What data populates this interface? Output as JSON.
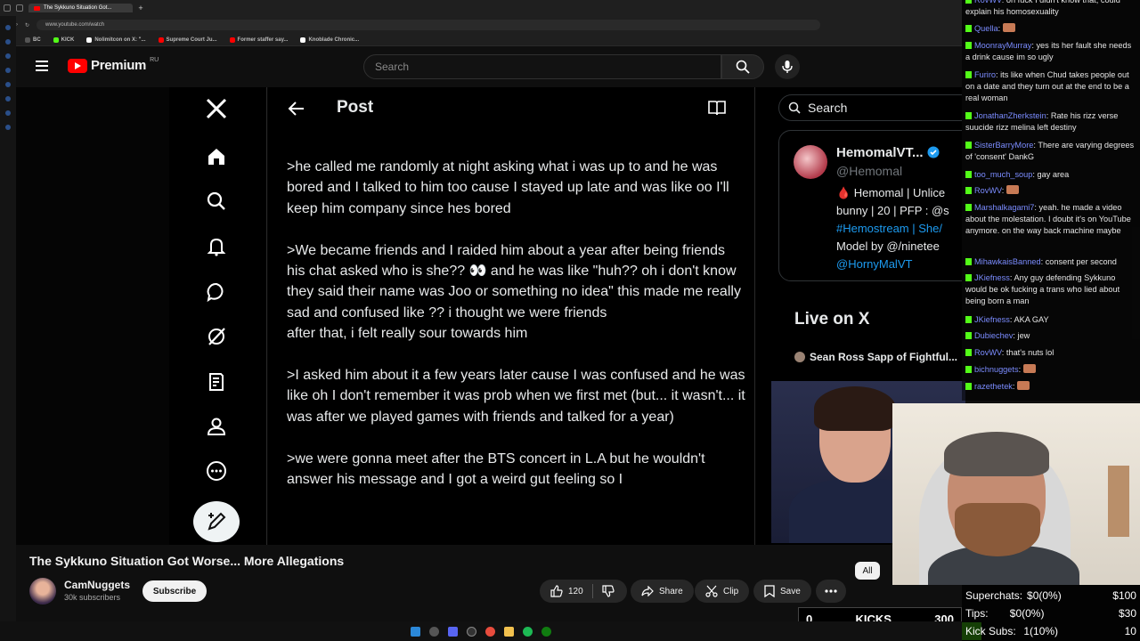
{
  "browser": {
    "active_tab": "The Sykkuno Situation Got...",
    "url": "www.youtube.com/watch",
    "bookmarks": [
      "BC",
      "KICK",
      "Nolimitcon on X: \"...",
      "Supreme Court Ju...",
      "Former staffer say...",
      "Knoblade Chronic..."
    ]
  },
  "youtube": {
    "brand": "Premium",
    "country": "RU",
    "search_placeholder": "Search",
    "video_title": "The Sykkuno Situation Got Worse... More Allegations",
    "channel_name": "CamNuggets",
    "channel_subs": "30k subscribers",
    "subscribe_label": "Subscribe",
    "like_count": "120",
    "share_label": "Share",
    "clip_label": "Clip",
    "save_label": "Save",
    "all_chip": "All",
    "colors": {
      "red": "#ff0000",
      "bg": "#0f0f0f",
      "pill": "#272727"
    }
  },
  "x_post": {
    "title": "Post",
    "paragraphs": [
      ">he called me randomly at night asking what i was up to and he was bored and I talked to him too cause I stayed up late and was like oo I'll keep him company since hes bored",
      ">We became friends and I raided him about a year after being friends",
      "his chat asked who is she?? 👀 and he was like \"huh?? oh i don't know they said their name was Joo or something no idea\" this made me really sad and confused like ?? i thought we were friends",
      "after that, i felt really sour towards him",
      ">I asked him about it a few years later cause I was confused and he was like oh I don't remember it was prob when we first met (but... it wasn't... it was after we played games with friends and talked for a year)",
      ">we were gonna meet after the BTS concert in L.A but he wouldn't answer his message and I got a weird gut feeling so I"
    ],
    "search_placeholder": "Search",
    "profile": {
      "name": "HemomalVT...",
      "handle": "@Hemomal",
      "bio_lines": [
        "🩸 Hemomal | Unlice",
        "bunny | 20 | PFP : @s",
        "#Hemostream | She/",
        "Model by @/ninetee",
        "@HornyMalVT"
      ]
    },
    "live_title": "Live on X",
    "live_item": "Sean Ross Sapp of Fightful..."
  },
  "chat": [
    {
      "user": "RovWV",
      "text": "oh fuck I didn't know that, could explain his homosexuality"
    },
    {
      "user": "Quella",
      "text": ""
    },
    {
      "user": "MoonrayMurray",
      "text": "yes its her fault she needs a drink cause im so ugly"
    },
    {
      "user": "Furiro",
      "text": "its like when Chud takes people out on a date and they turn out at the end to be a real woman"
    },
    {
      "user": "JonathanZherkstein",
      "text": "Rate his rizz verse suucide rizz melina left destiny"
    },
    {
      "user": "SisterBarryMore",
      "text": "There are varying degrees of 'consent' DankG"
    },
    {
      "user": "too_much_soup",
      "text": "gay area"
    },
    {
      "user": "RovWV",
      "text": ""
    },
    {
      "user": "Marshalkagami7",
      "text": "yeah. he made a video about the molestation. I doubt it's on YouTube anymore. on the way back machine maybe"
    },
    {
      "user": "MihawkaisBanned",
      "text": "consent per second"
    },
    {
      "user": "JKiefness",
      "text": "Any guy defending Sykkuno would be ok fucking a trans who lied about being born a man"
    },
    {
      "user": "JKiefness",
      "text": "AKA GAY"
    },
    {
      "user": "Dubiechev",
      "text": "jew"
    },
    {
      "user": "RovWV",
      "text": "that's nuts lol"
    },
    {
      "user": "bichnuggets",
      "text": ""
    },
    {
      "user": "razethetek",
      "text": ""
    }
  ],
  "stats": {
    "rows": [
      {
        "label": "Superchats:",
        "value": "$0(0%)",
        "goal": "$100"
      },
      {
        "label": "Tips:",
        "value": "$0(0%)",
        "goal": "$30"
      },
      {
        "label": "Kick Subs:",
        "value": "1(10%)",
        "goal": "10"
      }
    ],
    "kick_subs_progress": 0.1
  },
  "kicks": {
    "left": "0",
    "label": "KICKS",
    "right": "300"
  }
}
